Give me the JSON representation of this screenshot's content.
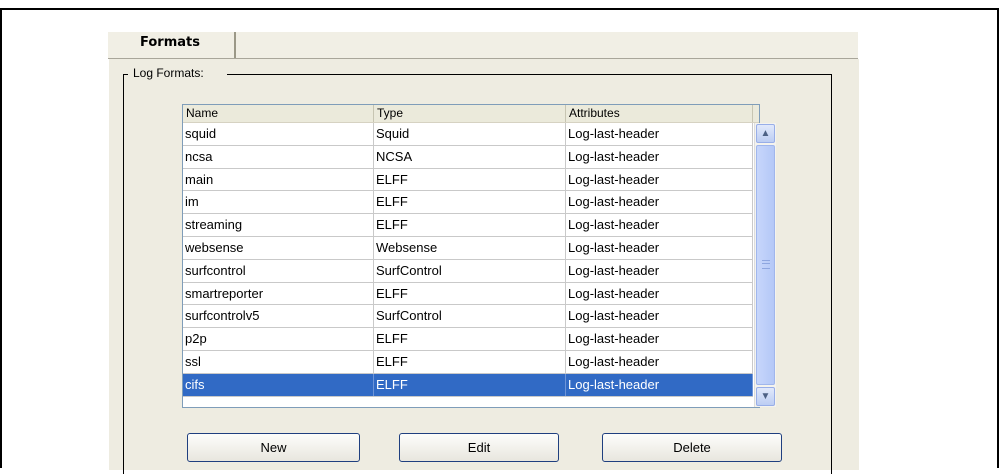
{
  "tabs": [
    {
      "label": "Formats"
    }
  ],
  "group": {
    "label": "Log Formats:"
  },
  "table": {
    "columns": [
      "Name",
      "Type",
      "Attributes"
    ],
    "rows": [
      {
        "name": "squid",
        "type": "Squid",
        "attributes": "Log-last-header"
      },
      {
        "name": "ncsa",
        "type": "NCSA",
        "attributes": "Log-last-header"
      },
      {
        "name": "main",
        "type": "ELFF",
        "attributes": "Log-last-header"
      },
      {
        "name": "im",
        "type": "ELFF",
        "attributes": "Log-last-header"
      },
      {
        "name": "streaming",
        "type": "ELFF",
        "attributes": "Log-last-header"
      },
      {
        "name": "websense",
        "type": "Websense",
        "attributes": "Log-last-header"
      },
      {
        "name": "surfcontrol",
        "type": "SurfControl",
        "attributes": "Log-last-header"
      },
      {
        "name": "smartreporter",
        "type": "ELFF",
        "attributes": "Log-last-header"
      },
      {
        "name": "surfcontrolv5",
        "type": "SurfControl",
        "attributes": "Log-last-header"
      },
      {
        "name": "p2p",
        "type": "ELFF",
        "attributes": "Log-last-header"
      },
      {
        "name": "ssl",
        "type": "ELFF",
        "attributes": "Log-last-header"
      },
      {
        "name": "cifs",
        "type": "ELFF",
        "attributes": "Log-last-header",
        "selected": true
      }
    ]
  },
  "buttons": {
    "new": "New",
    "edit": "Edit",
    "delete": "Delete"
  },
  "scrollbar": {
    "up_icon": "arrow-up-icon",
    "down_icon": "arrow-down-icon"
  },
  "colors": {
    "selection": "#316ac5",
    "panel": "#eeece1"
  }
}
